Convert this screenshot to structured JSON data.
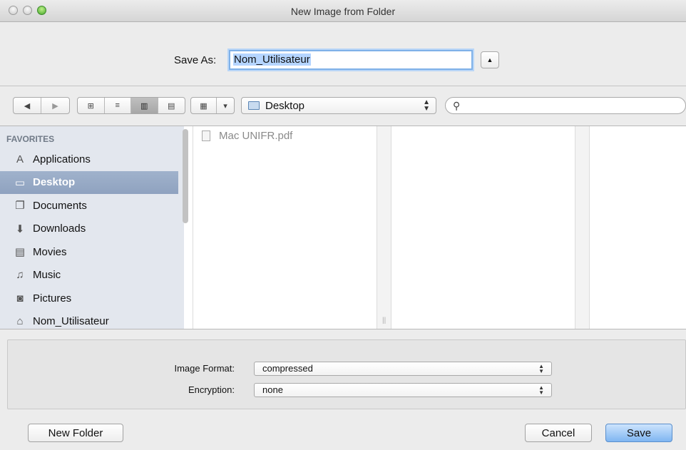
{
  "window": {
    "title": "New Image from Folder"
  },
  "save_as": {
    "label": "Save As:",
    "value": "Nom_Utilisateur"
  },
  "toolbar": {
    "back_glyph": "◀",
    "forward_glyph": "▶",
    "view_icons_glyph": "⊞",
    "view_list_glyph": "≡",
    "view_columns_glyph": "▥",
    "view_coverflow_glyph": "▤",
    "arrange_glyph": "▦",
    "arrange_arrow": "▾",
    "location": "Desktop",
    "search_placeholder": ""
  },
  "sidebar": {
    "section": "FAVORITES",
    "items": [
      {
        "label": "Applications",
        "icon": "applications-icon",
        "glyph": "A",
        "selected": false
      },
      {
        "label": "Desktop",
        "icon": "desktop-icon",
        "glyph": "▭",
        "selected": true
      },
      {
        "label": "Documents",
        "icon": "documents-icon",
        "glyph": "❐",
        "selected": false
      },
      {
        "label": "Downloads",
        "icon": "downloads-icon",
        "glyph": "⬇",
        "selected": false
      },
      {
        "label": "Movies",
        "icon": "movies-icon",
        "glyph": "▤",
        "selected": false
      },
      {
        "label": "Music",
        "icon": "music-icon",
        "glyph": "♫",
        "selected": false
      },
      {
        "label": "Pictures",
        "icon": "pictures-icon",
        "glyph": "◙",
        "selected": false
      },
      {
        "label": "Nom_Utilisateur",
        "icon": "home-icon",
        "glyph": "⌂",
        "selected": false
      }
    ]
  },
  "files": [
    {
      "name": "Mac UNIFR.pdf"
    }
  ],
  "options": {
    "image_format": {
      "label": "Image Format:",
      "value": "compressed"
    },
    "encryption": {
      "label": "Encryption:",
      "value": "none"
    }
  },
  "buttons": {
    "new_folder": "New Folder",
    "cancel": "Cancel",
    "save": "Save"
  },
  "colors": {
    "accent": "#7fb5f1",
    "selection": "#8fa2bf"
  }
}
